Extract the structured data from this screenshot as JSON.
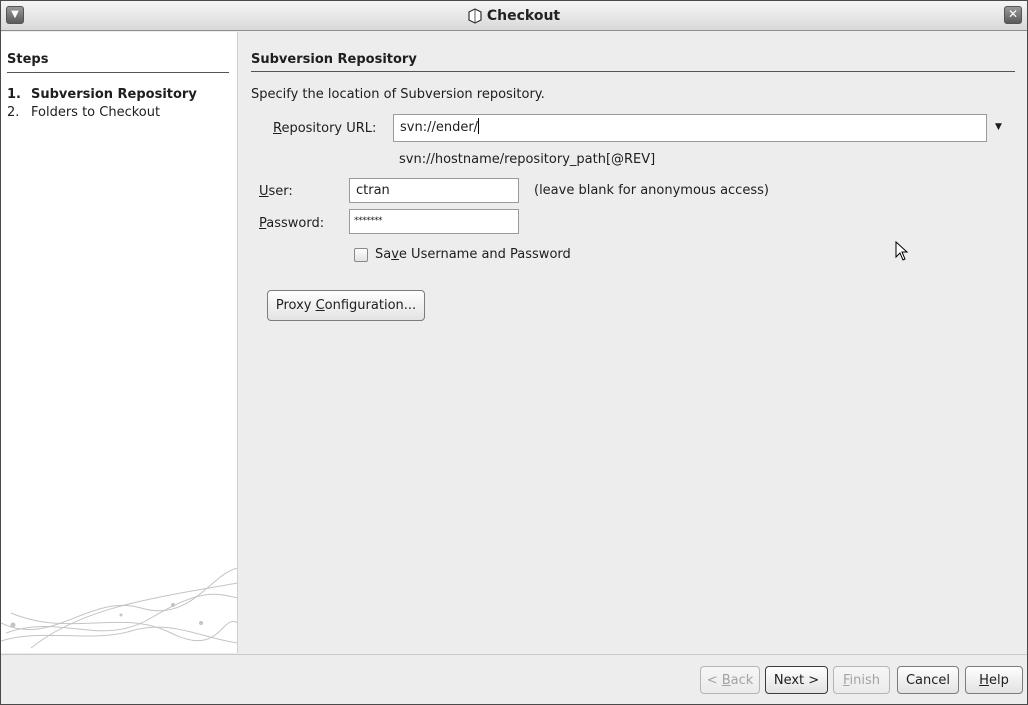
{
  "window": {
    "title": "Checkout",
    "menu_icon": "chevron-down-icon",
    "close_icon": "close-icon"
  },
  "steps": {
    "title": "Steps",
    "items": [
      {
        "num": "1.",
        "label": "Subversion Repository",
        "active": true
      },
      {
        "num": "2.",
        "label": "Folders to Checkout",
        "active": false
      }
    ]
  },
  "panel": {
    "title": "Subversion Repository",
    "instruction": "Specify the location of Subversion repository.",
    "repo_url": {
      "label_accel": "R",
      "label_rest": "epository URL:",
      "value": "svn://ender/",
      "hint": "svn://hostname/repository_path[@REV]"
    },
    "user": {
      "label_accel": "U",
      "label_rest": "ser:",
      "value": "ctran",
      "hint": "(leave blank for anonymous access)"
    },
    "password": {
      "label_accel": "P",
      "label_rest": "assword:",
      "value": "*******"
    },
    "save_credentials": {
      "pre": "Sa",
      "accel": "v",
      "post": "e Username and Password",
      "checked": false
    },
    "proxy_button": {
      "pre": "Proxy ",
      "accel": "C",
      "post": "onfiguration..."
    }
  },
  "buttons": {
    "back": {
      "pre": "< ",
      "accel": "B",
      "post": "ack",
      "enabled": false
    },
    "next": {
      "label": "Next >",
      "enabled": true
    },
    "finish": {
      "pre": "",
      "accel": "F",
      "post": "inish",
      "enabled": false
    },
    "cancel": {
      "label": "Cancel",
      "enabled": true
    },
    "help": {
      "pre": "",
      "accel": "H",
      "post": "elp",
      "enabled": true
    }
  },
  "colors": {
    "dialog_bg": "#ededed",
    "steps_bg": "#ffffff",
    "disabled_text": "#a3a3a3"
  }
}
